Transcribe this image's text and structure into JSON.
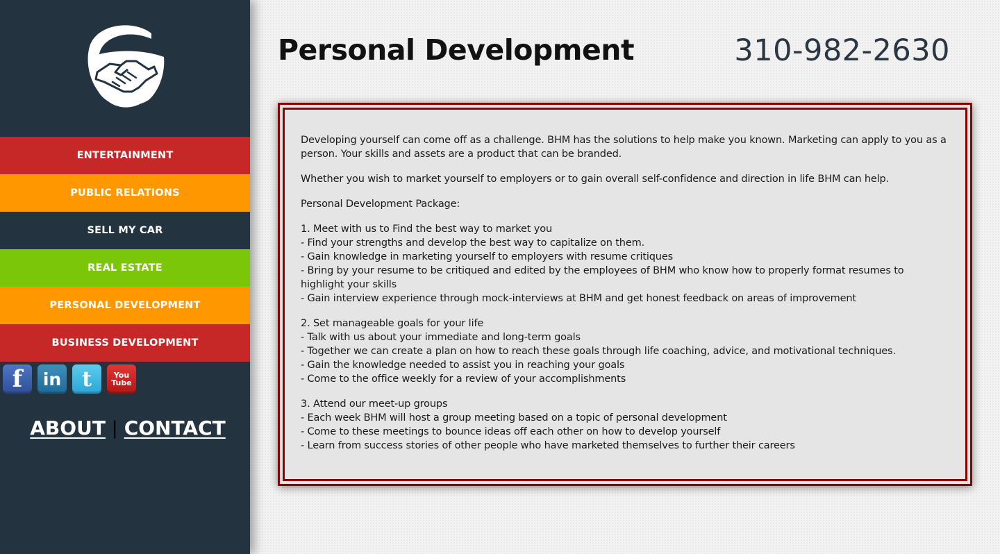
{
  "sidebar": {
    "logo": "handshake-logo",
    "nav": [
      {
        "label": "ENTERTAINMENT",
        "color": "#c62828"
      },
      {
        "label": "PUBLIC RELATIONS",
        "color": "#ff9800"
      },
      {
        "label": "SELL MY CAR",
        "color": "#243340"
      },
      {
        "label": "REAL ESTATE",
        "color": "#7cc60a"
      },
      {
        "label": "PERSONAL DEVELOPMENT",
        "color": "#ff9800"
      },
      {
        "label": "BUSINESS DEVELOPMENT",
        "color": "#c62828"
      }
    ],
    "social": {
      "facebook": "f",
      "linkedin": "in",
      "twitter": "t",
      "youtube_top": "You",
      "youtube_bottom": "Tube"
    },
    "footer": {
      "about": "ABOUT",
      "separator": "|",
      "contact": "CONTACT"
    }
  },
  "header": {
    "title": "Personal Development",
    "phone": "310-982-2630"
  },
  "content": {
    "intro": "Developing yourself can come off as a challenge. BHM has the solutions to help make you known. Marketing can apply to you as a person. Your skills and assets are a product that can be branded.",
    "p2": "Whether you wish to market yourself to employers or to gain overall self-confidence and direction in life BHM can help.",
    "package_heading": "Personal Development Package:",
    "section1": [
      "1. Meet with us to Find the best way to market you",
      "- Find your strengths and develop the best way to capitalize on them.",
      "- Gain knowledge in marketing yourself to employers with resume critiques",
      "- Bring by your resume to be critiqued and edited by the employees of BHM who know how to properly format resumes to highlight your skills",
      "- Gain interview experience through mock-interviews at BHM and get honest feedback on areas of improvement"
    ],
    "section2": [
      "2. Set manageable goals for your life",
      "- Talk with us about your immediate and long-term goals",
      "- Together we can create a plan on how to reach these goals through life coaching, advice, and motivational techniques.",
      "- Gain the knowledge needed to assist you in reaching your goals",
      "- Come to the office weekly for a review of your accomplishments"
    ],
    "section3": [
      "3. Attend our meet-up groups",
      "- Each week BHM will host a group meeting based on a topic of personal development",
      "- Come to these meetings to bounce ideas off each other on how to develop yourself",
      "- Learn from success stories of other people who have marketed themselves to further their careers"
    ]
  },
  "colors": {
    "sidebar": "#243340",
    "border": "#8b0000"
  }
}
